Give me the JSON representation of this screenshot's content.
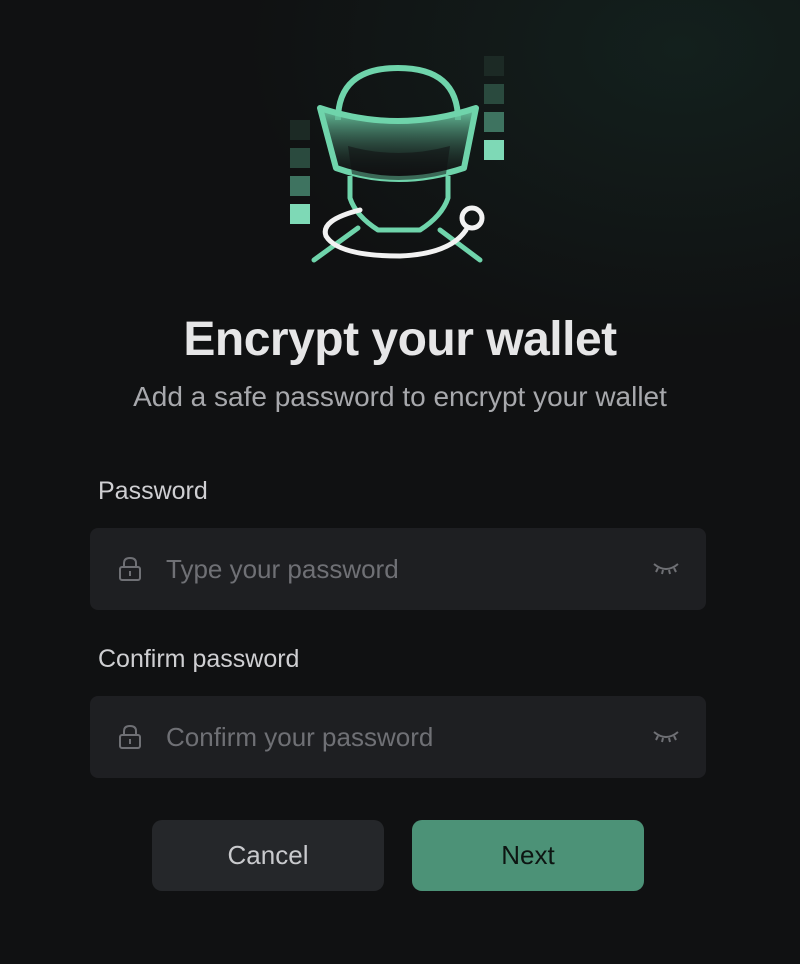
{
  "header": {
    "title": "Encrypt your wallet",
    "subtitle": "Add a safe password to encrypt your wallet"
  },
  "form": {
    "password": {
      "label": "Password",
      "placeholder": "Type your password",
      "value": ""
    },
    "confirm": {
      "label": "Confirm password",
      "placeholder": "Confirm your password",
      "value": ""
    }
  },
  "actions": {
    "cancel_label": "Cancel",
    "next_label": "Next"
  },
  "icons": {
    "hero": "astronaut-illustration",
    "field_lead": "lock-icon",
    "field_trail": "eye-closed-icon"
  },
  "colors": {
    "background": "#101112",
    "accent": "#6fd4ab",
    "primary_button": "#4c9277",
    "field_background": "#1e1f22"
  }
}
